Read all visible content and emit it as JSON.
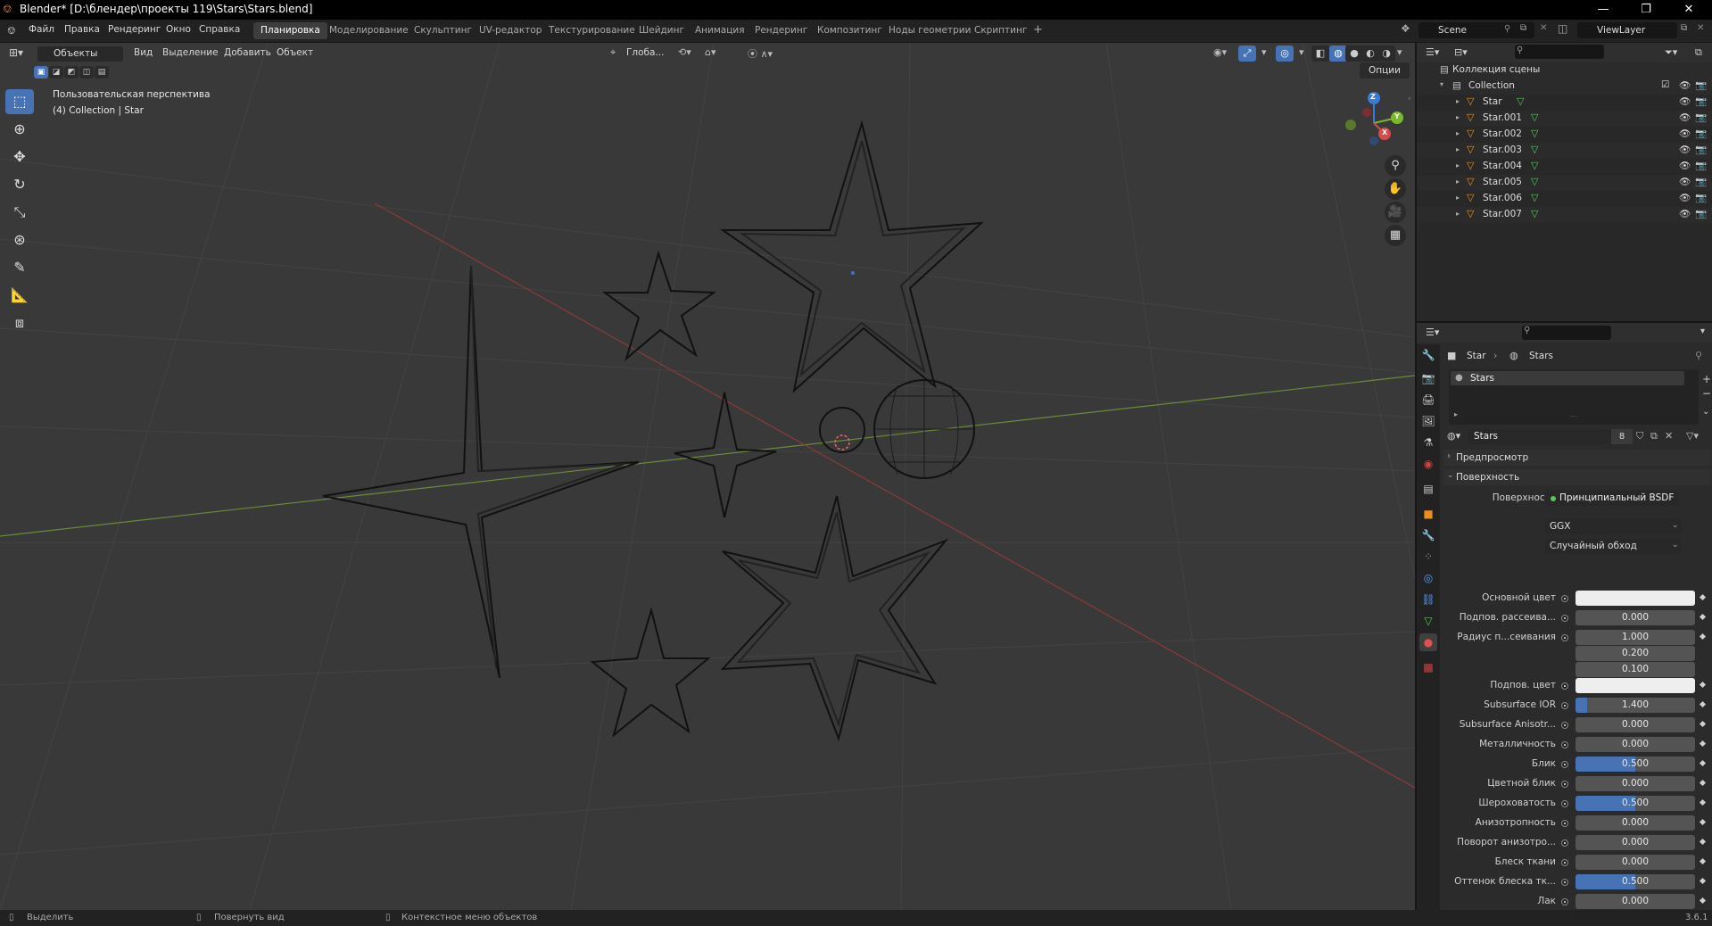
{
  "window": {
    "title": "Blender* [D:\\блендер\\проекты 119\\Stars\\Stars.blend]",
    "minimize": "—",
    "maximize": "❐",
    "close": "✕"
  },
  "menu": [
    "Файл",
    "Правка",
    "Рендеринг",
    "Окно",
    "Справка"
  ],
  "workspaces": [
    "Планировка",
    "Моделирование",
    "Скульптинг",
    "UV-редактор",
    "Текстурирование",
    "Шейдинг",
    "Анимация",
    "Рендеринг",
    "Композитинг",
    "Ноды геометрии",
    "Скриптинг"
  ],
  "active_workspace_index": 0,
  "scene": {
    "name": "Scene",
    "view_layer": "ViewLayer"
  },
  "viewport": {
    "mode": "Объекты",
    "menus": [
      "Вид",
      "Выделение",
      "Добавить",
      "Объект"
    ],
    "orientation": "Глоба...",
    "options": "Опции",
    "view_name": "Пользовательская перспектива",
    "collection_info": "(4) Collection | Star"
  },
  "gizmo": {
    "z": "Z",
    "y": "Y",
    "x": "X"
  },
  "outliner": {
    "root": "Коллекция сцены",
    "collection": "Collection",
    "objects": [
      "Star",
      "Star.001",
      "Star.002",
      "Star.003",
      "Star.004",
      "Star.005",
      "Star.006",
      "Star.007"
    ]
  },
  "properties": {
    "breadcrumb": {
      "object": "Star",
      "material": "Stars"
    },
    "slot": "Stars",
    "material_name": "Stars",
    "users": "8",
    "panels": {
      "preview": "Предпросмотр",
      "surface": "Поверхность"
    },
    "surface": {
      "label": "Поверхность",
      "shader": "Принципиальный BSDF"
    },
    "distribution": "GGX",
    "subsurface_method": "Случайный обход",
    "rows": [
      {
        "label": "Основной цвет",
        "type": "color",
        "color": "#eeeeee"
      },
      {
        "label": "Подпов. рассеива...",
        "type": "num",
        "value": "0.000",
        "fill": 0
      },
      {
        "label": "Радиус п...сеивания",
        "type": "num",
        "value": "1.000",
        "fill": 0
      },
      {
        "label": "",
        "type": "num",
        "value": "0.200",
        "fill": 0
      },
      {
        "label": "",
        "type": "num",
        "value": "0.100",
        "fill": 0
      },
      {
        "label": "Подпов. цвет",
        "type": "color",
        "color": "#eeeeee"
      },
      {
        "label": "Subsurface IOR",
        "type": "num",
        "value": "1.400",
        "fill": 0.1
      },
      {
        "label": "Subsurface Anisotr...",
        "type": "num",
        "value": "0.000",
        "fill": 0
      },
      {
        "label": "Металличность",
        "type": "num",
        "value": "0.000",
        "fill": 0
      },
      {
        "label": "Блик",
        "type": "num",
        "value": "0.500",
        "fill": 0.5
      },
      {
        "label": "Цветной блик",
        "type": "num",
        "value": "0.000",
        "fill": 0
      },
      {
        "label": "Шероховатость",
        "type": "num",
        "value": "0.500",
        "fill": 0.5
      },
      {
        "label": "Анизотропность",
        "type": "num",
        "value": "0.000",
        "fill": 0
      },
      {
        "label": "Поворот анизотро...",
        "type": "num",
        "value": "0.000",
        "fill": 0
      },
      {
        "label": "Блеск ткани",
        "type": "num",
        "value": "0.000",
        "fill": 0
      },
      {
        "label": "Оттенок блеска тк...",
        "type": "num",
        "value": "0.500",
        "fill": 0.5
      },
      {
        "label": "Лак",
        "type": "num",
        "value": "0.000",
        "fill": 0
      }
    ]
  },
  "statusbar": {
    "select": "Выделить",
    "rotate": "Повернуть вид",
    "context": "Контекстное меню объектов",
    "version": "3.6.1"
  }
}
